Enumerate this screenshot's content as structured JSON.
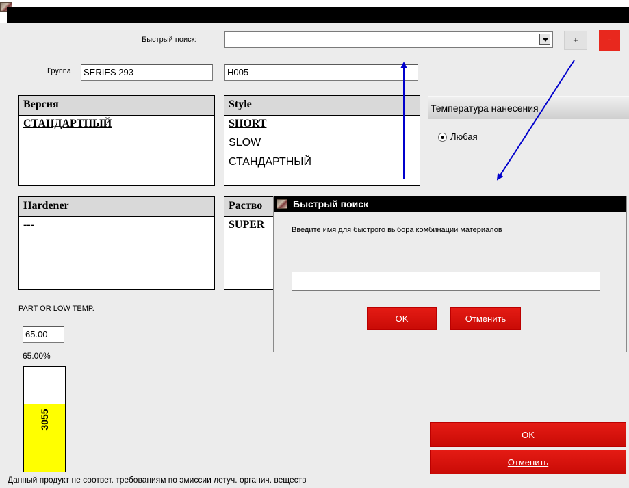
{
  "quick_search": {
    "label": "Быстрый поиск:",
    "value": "",
    "add_label": "+",
    "remove_label": "-"
  },
  "group": {
    "label": "Группа",
    "value": "SERIES 293",
    "code_value": "H005"
  },
  "version_panel": {
    "header": "Версия",
    "items": [
      "СТАНДАРТНЫЙ"
    ]
  },
  "style_panel": {
    "header": "Style",
    "items": [
      "SHORT",
      "SLOW",
      "СТАНДАРТНЫЙ"
    ]
  },
  "hardener_panel": {
    "header": "Hardener",
    "items": [
      "---"
    ]
  },
  "solvent_panel": {
    "header": "Раство",
    "items": [
      "SUPER"
    ]
  },
  "temperature": {
    "header": "Температура нанесения",
    "option_label": "Любая",
    "selected": true
  },
  "part_label": "PART OR LOW TEMP.",
  "part_value": "65.00",
  "percent_text": "65.00%",
  "percent_bar": {
    "label": "3055",
    "fill_fraction": 0.65,
    "fill_color": "#ffff00"
  },
  "footer_buttons": {
    "ok_label": "OK",
    "cancel_label": "Отменить"
  },
  "compliance_note": "Данный продукт не соответ. требованиям по эмиссии летуч. органич. веществ",
  "dialog": {
    "title": "Быстрый поиск",
    "prompt": "Введите имя для быстрого выбора комбинации материалов",
    "input_value": "",
    "ok_label": "OK",
    "cancel_label": "Отменить"
  },
  "colors": {
    "accent_red": "#e41b14",
    "arrow_blue": "#0000cc",
    "fill_yellow": "#ffff00"
  }
}
